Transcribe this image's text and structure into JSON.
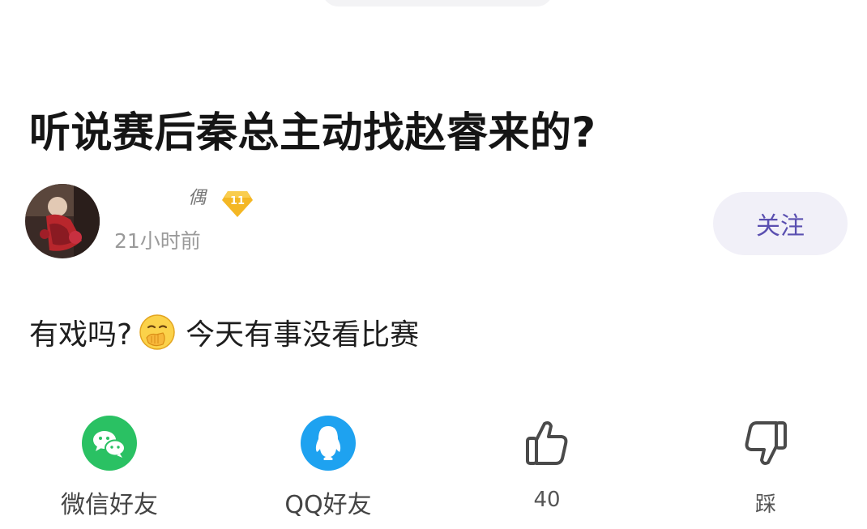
{
  "post": {
    "title": "听说赛后秦总主动找赵睿来的?",
    "author": {
      "name": "偶",
      "level": "11",
      "time": "21小时前"
    },
    "follow_label": "关注",
    "content_before_emoji": "有戏吗?",
    "content_emoji": "hand-over-mouth-emoji",
    "content_after_emoji": "今天有事没看比赛"
  },
  "actions": {
    "wechat": {
      "label": "微信好友",
      "icon": "wechat-icon",
      "color": "#2ac163"
    },
    "qq": {
      "label": "QQ好友",
      "icon": "qq-icon",
      "color": "#1ea2f0"
    },
    "like": {
      "label": "40",
      "icon": "thumbs-up-icon"
    },
    "dislike": {
      "label": "踩",
      "icon": "thumbs-down-icon"
    }
  },
  "colors": {
    "follow_text": "#5a4fb0",
    "follow_bg": "#f1f0f8",
    "badge": "#f4b724"
  }
}
